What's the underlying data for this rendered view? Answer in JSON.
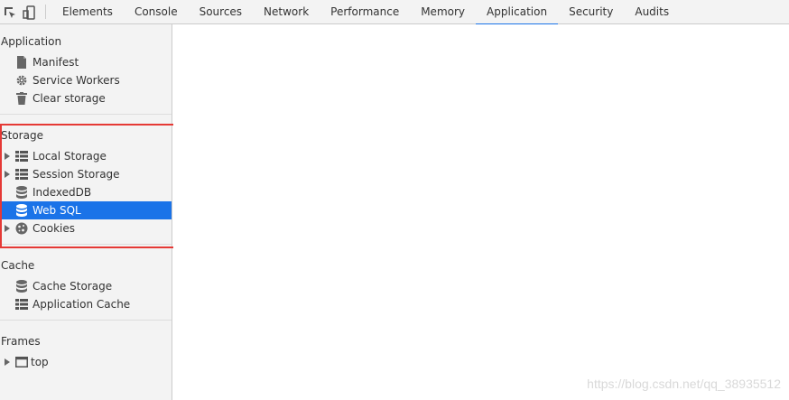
{
  "toolbar": {
    "inspect_icon": "inspect-cursor-icon",
    "device_icon": "device-toggle-icon",
    "tabs": [
      "Elements",
      "Console",
      "Sources",
      "Network",
      "Performance",
      "Memory",
      "Application",
      "Security",
      "Audits"
    ],
    "active_tab": "Application",
    "accent_color": "#1a73e8"
  },
  "sidebar": {
    "application": {
      "title": "Application",
      "items": [
        {
          "label": "Manifest",
          "icon": "document-icon"
        },
        {
          "label": "Service Workers",
          "icon": "gear-icon"
        },
        {
          "label": "Clear storage",
          "icon": "trash-icon"
        }
      ]
    },
    "storage": {
      "title": "Storage",
      "items": [
        {
          "label": "Local Storage",
          "icon": "grid-icon",
          "expandable": true
        },
        {
          "label": "Session Storage",
          "icon": "grid-icon",
          "expandable": true
        },
        {
          "label": "IndexedDB",
          "icon": "database-icon",
          "expandable": false
        },
        {
          "label": "Web SQL",
          "icon": "database-icon",
          "expandable": false,
          "selected": true
        },
        {
          "label": "Cookies",
          "icon": "cookie-icon",
          "expandable": true
        }
      ]
    },
    "cache": {
      "title": "Cache",
      "items": [
        {
          "label": "Cache Storage",
          "icon": "database-icon"
        },
        {
          "label": "Application Cache",
          "icon": "grid-icon"
        }
      ]
    },
    "frames": {
      "title": "Frames",
      "items": [
        {
          "label": "top",
          "icon": "frame-icon",
          "expandable": true
        }
      ]
    }
  },
  "highlight_color": "#e53935",
  "watermark": "https://blog.csdn.net/qq_38935512"
}
